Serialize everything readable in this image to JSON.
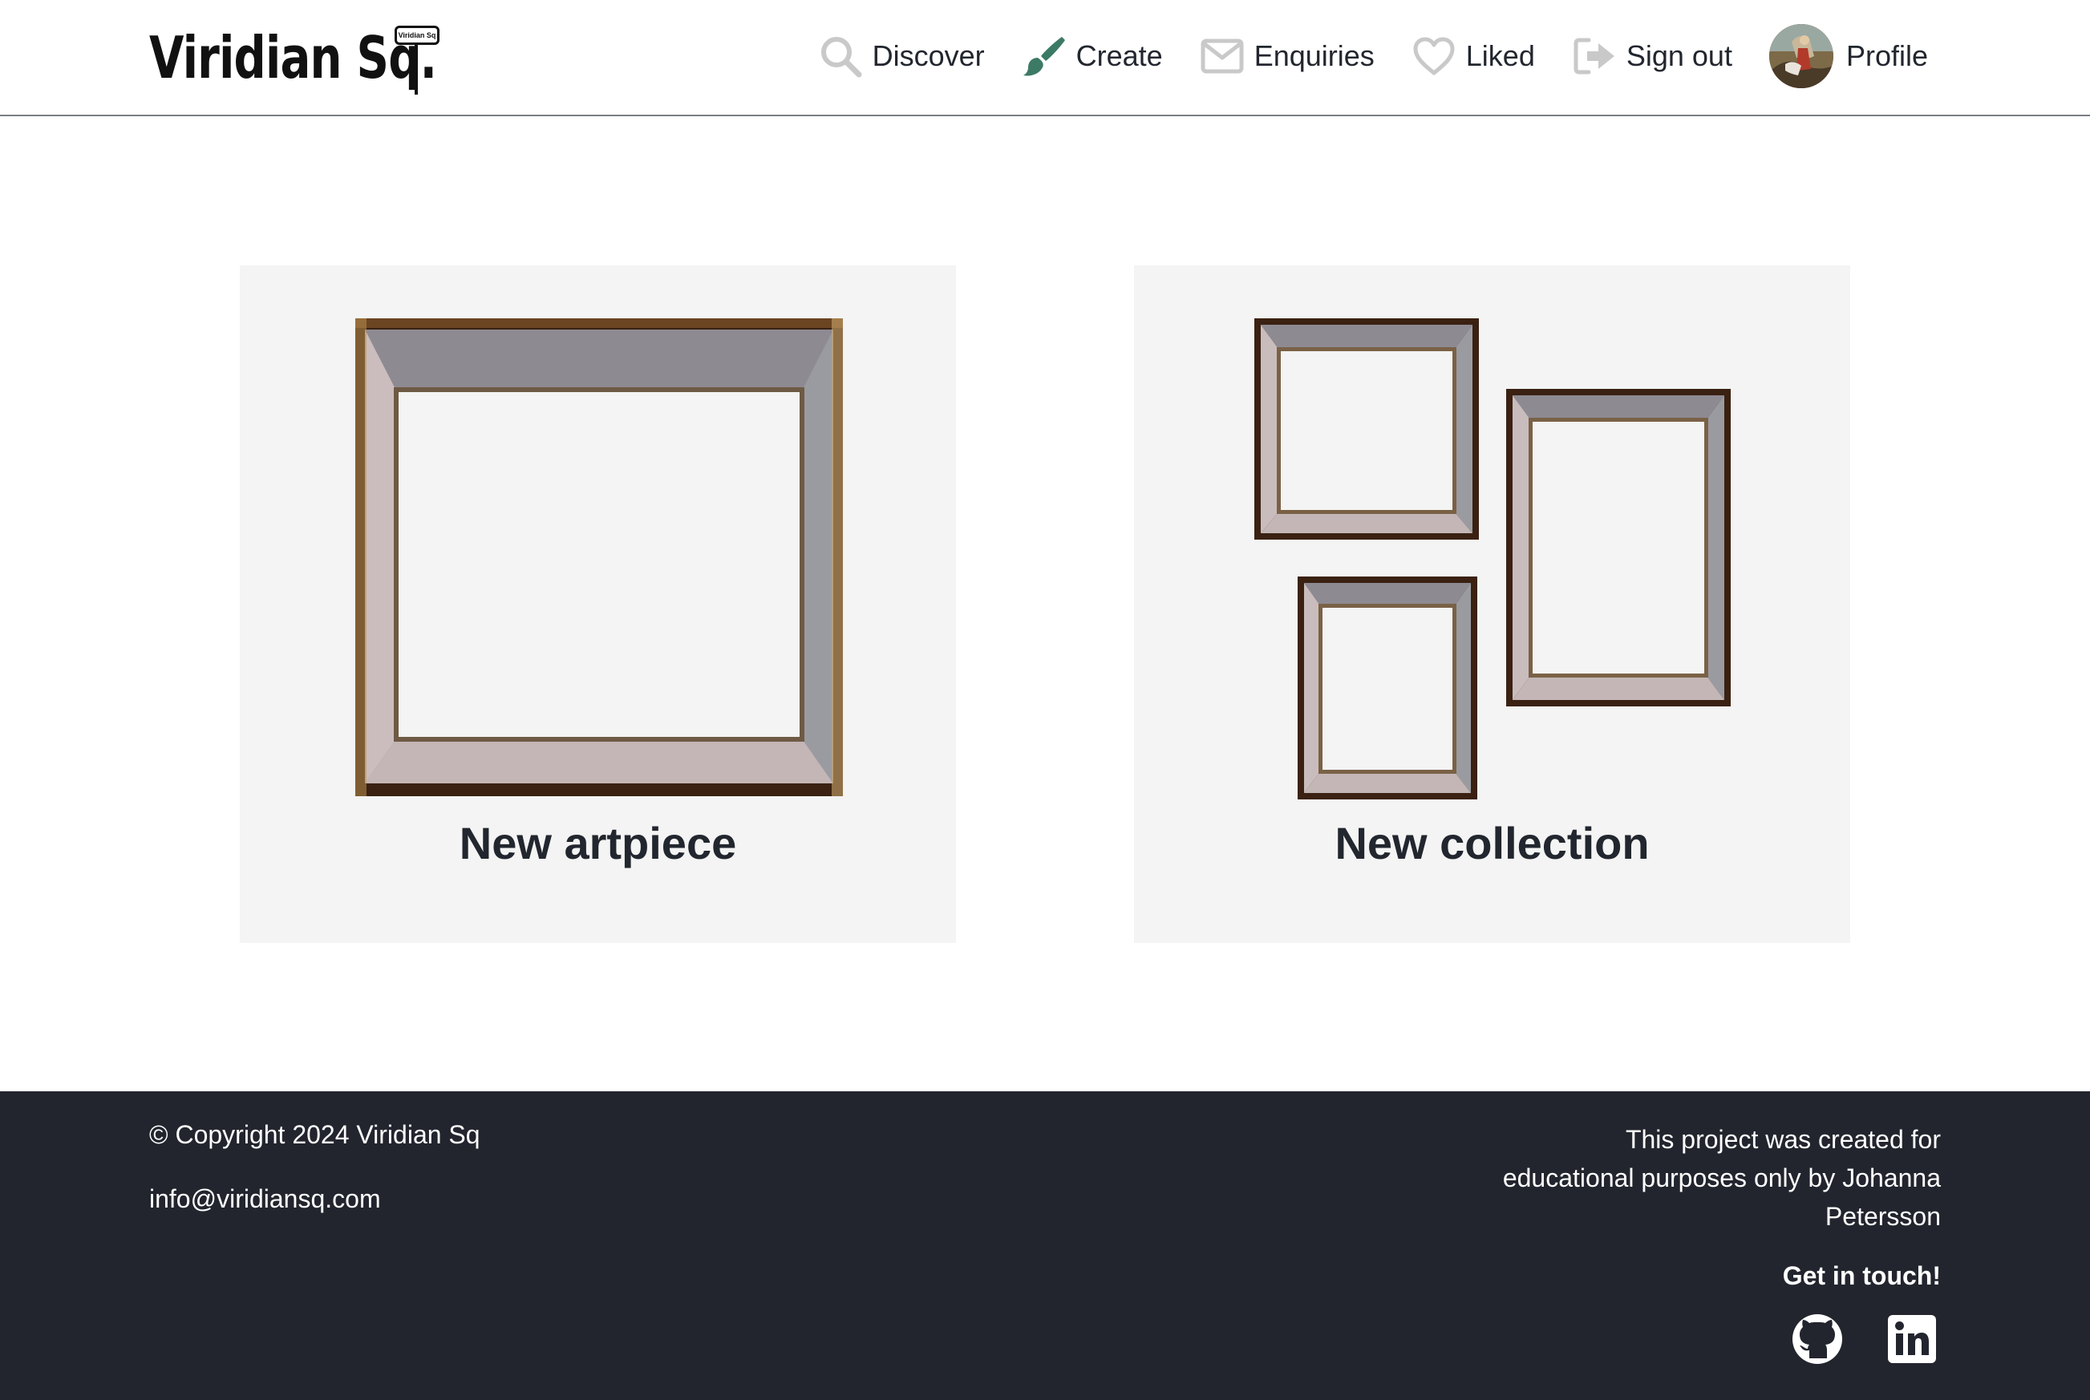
{
  "header": {
    "logo_text": "Viridian Sq.",
    "logo_sign_text": "Viridian Sq"
  },
  "nav": {
    "items": [
      {
        "label": "Discover",
        "icon": "search-icon"
      },
      {
        "label": "Create",
        "icon": "paintbrush-icon"
      },
      {
        "label": "Enquiries",
        "icon": "envelope-icon"
      },
      {
        "label": "Liked",
        "icon": "heart-icon"
      },
      {
        "label": "Sign out",
        "icon": "sign-out-icon"
      },
      {
        "label": "Profile",
        "icon": "avatar"
      }
    ]
  },
  "cards": [
    {
      "title": "New artpiece",
      "icon": "single-frame-image"
    },
    {
      "title": "New collection",
      "icon": "multiple-frames-image"
    }
  ],
  "footer": {
    "copyright": "© Copyright 2024 Viridian Sq",
    "email": "info@viridiansq.com",
    "about": "This project was created for educational purposes only by Johanna Petersson",
    "contact_heading": "Get in touch!",
    "social": [
      {
        "icon": "github-icon"
      },
      {
        "icon": "linkedin-icon"
      }
    ]
  },
  "colors": {
    "accent": "#3d7a65",
    "icon_grey": "#c9c9c9",
    "card_bg": "#f3f4f3",
    "footer_bg": "#22252e",
    "text_dark": "#22262e"
  }
}
